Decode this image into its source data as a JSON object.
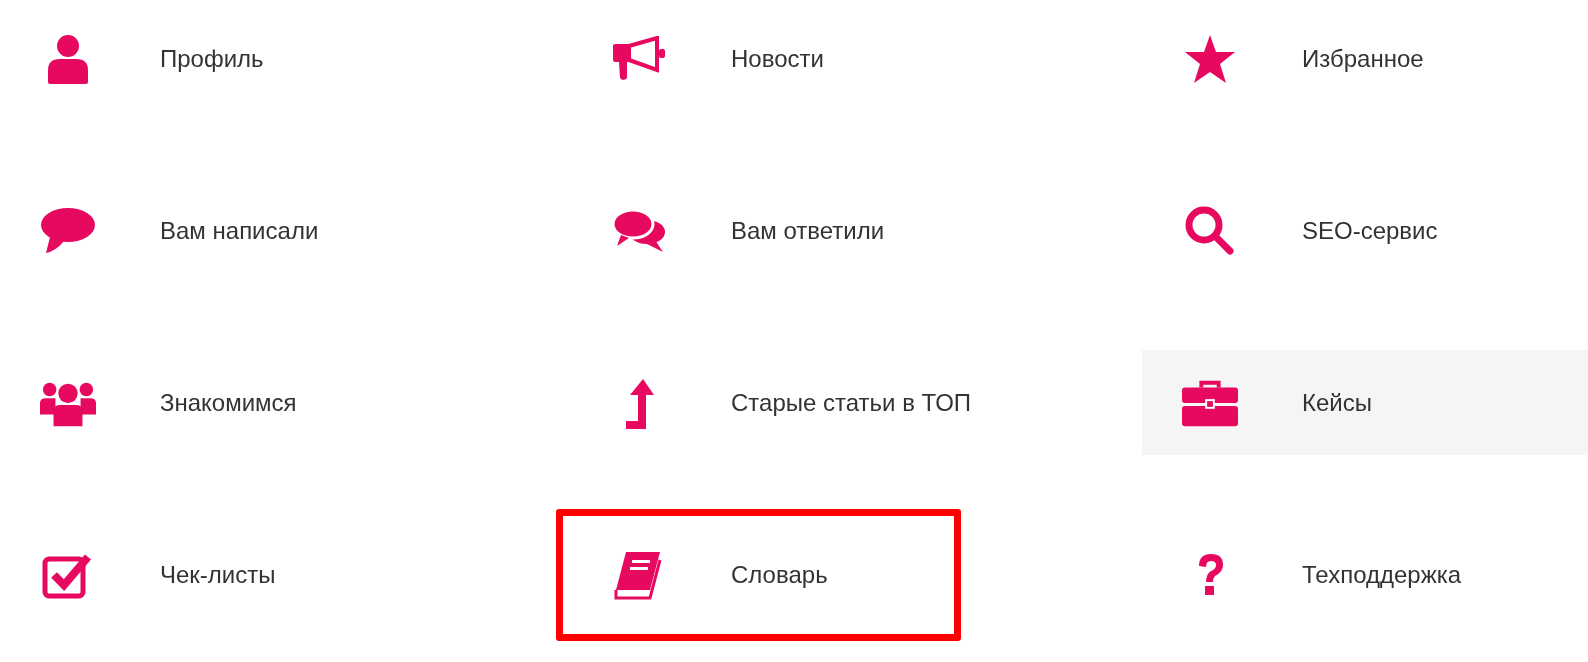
{
  "menu_items": [
    {
      "label": "Профиль",
      "hovered": false,
      "outlined": false
    },
    {
      "label": "Новости",
      "hovered": false,
      "outlined": false
    },
    {
      "label": "Избранное",
      "hovered": false,
      "outlined": false
    },
    {
      "label": "Вам написали",
      "hovered": false,
      "outlined": false
    },
    {
      "label": "Вам ответили",
      "hovered": false,
      "outlined": false
    },
    {
      "label": "SEO-сервис",
      "hovered": false,
      "outlined": false
    },
    {
      "label": "Знакомимся",
      "hovered": false,
      "outlined": false
    },
    {
      "label": "Старые статьи в ТОП",
      "hovered": false,
      "outlined": false
    },
    {
      "label": "Кейсы",
      "hovered": true,
      "outlined": false
    },
    {
      "label": "Чек-листы",
      "hovered": false,
      "outlined": false
    },
    {
      "label": "Словарь",
      "hovered": false,
      "outlined": true
    },
    {
      "label": "Техподдержка",
      "hovered": false,
      "outlined": false
    }
  ]
}
